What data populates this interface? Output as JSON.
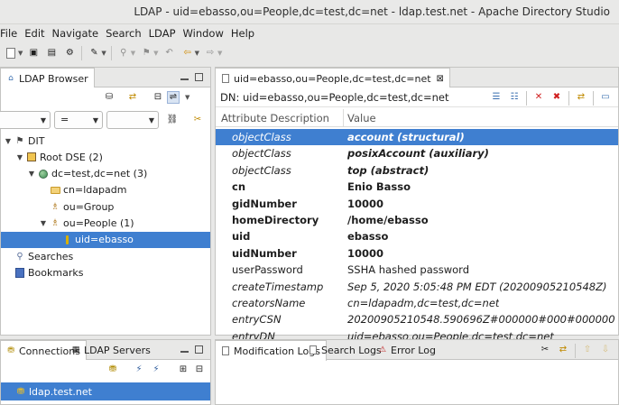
{
  "window": {
    "title": "LDAP - uid=ebasso,ou=People,dc=test,dc=net - ldap.test.net - Apache Directory Studio"
  },
  "menu": [
    "File",
    "Edit",
    "Navigate",
    "Search",
    "LDAP",
    "Window",
    "Help"
  ],
  "browser": {
    "tab_label": "LDAP Browser",
    "filter_operator": "=",
    "tree": [
      {
        "label": "DIT",
        "icon": "dit-icon",
        "indent": 0,
        "twisty": "expanded"
      },
      {
        "label": "Root DSE (2)",
        "icon": "root-dse-icon",
        "indent": 1,
        "twisty": "expanded"
      },
      {
        "label": "dc=test,dc=net (3)",
        "icon": "globe-icon",
        "indent": 2,
        "twisty": "expanded"
      },
      {
        "label": "cn=ldapadm",
        "icon": "folder-icon",
        "indent": 3,
        "twisty": "none"
      },
      {
        "label": "ou=Group",
        "icon": "people-icon",
        "indent": 3,
        "twisty": "none"
      },
      {
        "label": "ou=People (1)",
        "icon": "people-icon",
        "indent": 3,
        "twisty": "expanded"
      },
      {
        "label": "uid=ebasso",
        "icon": "entry-icon",
        "indent": 4,
        "twisty": "none",
        "selected": true
      },
      {
        "label": "Searches",
        "icon": "searches-icon",
        "indent": 0,
        "twisty": "none"
      },
      {
        "label": "Bookmarks",
        "icon": "bookmarks-icon",
        "indent": 0,
        "twisty": "none"
      }
    ]
  },
  "connections": {
    "tabs": [
      "Connections",
      "LDAP Servers"
    ],
    "items": [
      {
        "label": "ldap.test.net",
        "selected": true
      }
    ]
  },
  "editor": {
    "tab_label": "uid=ebasso,ou=People,dc=test,dc=net",
    "dn_line": "DN: uid=ebasso,ou=People,dc=test,dc=net",
    "columns": [
      "Attribute Description",
      "Value"
    ],
    "rows": [
      {
        "attr": "objectClass",
        "value": "account (structural)",
        "style": "ital-bold",
        "selected": true
      },
      {
        "attr": "objectClass",
        "value": "posixAccount (auxiliary)",
        "style": "ital-bold"
      },
      {
        "attr": "objectClass",
        "value": "top (abstract)",
        "style": "ital-bold"
      },
      {
        "attr": "cn",
        "value": "Enio Basso",
        "style": "bold"
      },
      {
        "attr": "gidNumber",
        "value": "10000",
        "style": "bold"
      },
      {
        "attr": "homeDirectory",
        "value": "/home/ebasso",
        "style": "bold"
      },
      {
        "attr": "uid",
        "value": "ebasso",
        "style": "bold"
      },
      {
        "attr": "uidNumber",
        "value": "10000",
        "style": "bold"
      },
      {
        "attr": "userPassword",
        "value": "SSHA hashed password",
        "style": "normal"
      },
      {
        "attr": "createTimestamp",
        "value": "Sep 5, 2020 5:05:48 PM EDT (20200905210548Z)",
        "style": "ital"
      },
      {
        "attr": "creatorsName",
        "value": "cn=ldapadm,dc=test,dc=net",
        "style": "ital"
      },
      {
        "attr": "entryCSN",
        "value": "20200905210548.590696Z#000000#000#000000",
        "style": "ital"
      },
      {
        "attr": "entryDN",
        "value": "uid=ebasso,ou=People,dc=test,dc=net",
        "style": "ital"
      }
    ]
  },
  "logs": {
    "tabs": [
      "Modification Logs",
      "Search Logs",
      "Error Log"
    ]
  },
  "colors": {
    "selection": "#3f7fd0",
    "panel_border": "#c4c4c2",
    "chrome": "#e8e8e7"
  }
}
